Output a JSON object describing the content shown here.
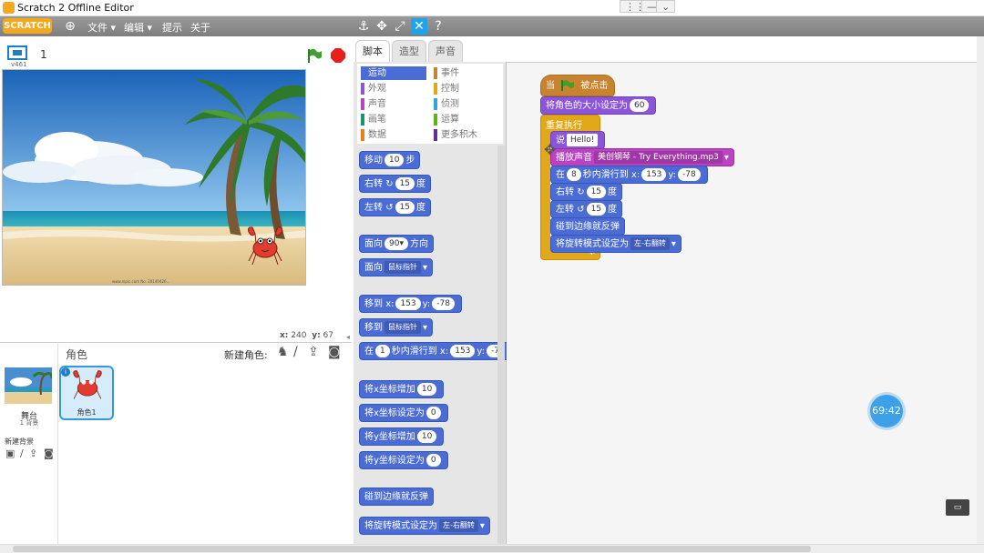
{
  "window": {
    "title": "Scratch 2 Offline Editor",
    "controls": [
      "⋮⋮",
      "—",
      "⌄"
    ]
  },
  "menu": {
    "logo": "SCRATCH",
    "items": [
      "文件 ▾",
      "编辑 ▾",
      "提示",
      "关于"
    ],
    "toolbar_icons": [
      "stamp-icon",
      "cut-icon",
      "grow-icon",
      "shrink-icon",
      "help-icon"
    ]
  },
  "stage": {
    "version": "v461",
    "sprite_index": "1",
    "x_label": "x:",
    "x_value": "240",
    "y_label": "y:",
    "y_value": "67",
    "watermark": "www.nipic.com  No. 20140426..."
  },
  "sprite_panel": {
    "title": "角色",
    "new_sprite": "新建角色:",
    "stage_label": "舞台",
    "stage_sub": "1 背景",
    "new_backdrop": "新建背景",
    "sprite_name": "角色1"
  },
  "tabs": [
    "脚本",
    "造型",
    "声音"
  ],
  "categories": [
    {
      "label": "运动",
      "color": "#4a6cd4"
    },
    {
      "label": "外观",
      "color": "#8a55d7"
    },
    {
      "label": "声音",
      "color": "#bb42c3"
    },
    {
      "label": "画笔",
      "color": "#0e9a6c"
    },
    {
      "label": "数据",
      "color": "#ee7d16"
    },
    {
      "label": "事件",
      "color": "#c88330"
    },
    {
      "label": "控制",
      "color": "#e1a91a"
    },
    {
      "label": "侦测",
      "color": "#2ca5e2"
    },
    {
      "label": "运算",
      "color": "#5cb712"
    },
    {
      "label": "更多积木",
      "color": "#632d99"
    }
  ],
  "palette": {
    "move": "移动",
    "move_n": "10",
    "steps": "步",
    "turn_right": "右转",
    "turn_left": "左转",
    "deg_n": "15",
    "deg": "度",
    "point_dir": "面向",
    "dir_n": "90▾",
    "dir": "方向",
    "point_towards": "面向",
    "mouse": "鼠标指针",
    "goto": "移到",
    "x": "x:",
    "goto_x": "153",
    "y": "y:",
    "goto_y": "-78",
    "goto2": "移到",
    "glide_in": "在",
    "glide_n": "1",
    "glide_text": "秒内滑行到",
    "glide_x": "153",
    "glide_y": "-7",
    "change_x": "将x坐标增加",
    "change_x_n": "10",
    "set_x": "将x坐标设定为",
    "set_x_n": "0",
    "change_y": "将y坐标增加",
    "change_y_n": "10",
    "set_y": "将y坐标设定为",
    "set_y_n": "0",
    "bounce": "碰到边缘就反弹",
    "rotation": "将旋转模式设定为",
    "rotation_v": "左-右翻转"
  },
  "script": {
    "when": "当",
    "clicked": "被点击",
    "set_size": "将角色的大小设定为",
    "size_n": "60",
    "forever": "重复执行",
    "say": "说",
    "say_text": "Hello!",
    "play_sound": "播放声音",
    "sound_name": "美创钢琴 - Try Everything.mp3",
    "glide_in": "在",
    "glide_n": "8",
    "glide_text": "秒内滑行到",
    "x": "x:",
    "glide_x": "153",
    "y": "y:",
    "glide_y": "-78",
    "turn_right": "右转",
    "turn_left": "左转",
    "deg_n": "15",
    "deg": "度",
    "bounce": "碰到边缘就反弹",
    "rotation": "将旋转模式设定为",
    "rotation_v": "左-右翻转"
  },
  "timer": "69:42",
  "colors": {
    "accent": "#1fa3ea",
    "motion": "#4a6cd4",
    "control": "#e1a91a",
    "events": "#c88330",
    "sound": "#bb42c3",
    "looks": "#8a55d7"
  }
}
